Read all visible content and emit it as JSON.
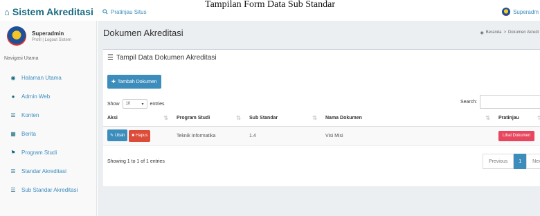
{
  "caption": "Tampilan Form Data Sub Standar",
  "brand": {
    "title": "Sistem Akreditasi",
    "home_icon": "home-icon"
  },
  "topbar": {
    "preview_link": "Pratinjau Situs",
    "user_name": "Superadm"
  },
  "sidebar": {
    "user_name": "Superadmin",
    "profile_link": "Profil",
    "logout_link": "Logout Sistem",
    "nav_header": "Navigasi Utama",
    "items": [
      {
        "label": "Halaman Utama",
        "icon": "dashboard-icon"
      },
      {
        "label": "Admin Web",
        "icon": "user-icon"
      },
      {
        "label": "Konten",
        "icon": "list-icon"
      },
      {
        "label": "Berita",
        "icon": "news-icon"
      },
      {
        "label": "Program Studi",
        "icon": "flag-icon"
      },
      {
        "label": "Standar Akreditasi",
        "icon": "list-icon"
      },
      {
        "label": "Sub Standar Akreditasi",
        "icon": "list-icon"
      }
    ]
  },
  "main": {
    "page_title": "Dokumen Akreditasi",
    "breadcrumb": {
      "home": "Beranda",
      "current": "Dokumen Akredi"
    },
    "box_title": "Tampil Data Dokumen Akreditasi",
    "add_button": "Tambah Dokumen",
    "show_label": "Show",
    "entries_value": "10",
    "entries_label": "entries",
    "search_label": "Search:",
    "columns": [
      "Aksi",
      "Program Studi",
      "Sub Standar",
      "Nama Dokumen",
      "Pratinjau"
    ],
    "rows": [
      {
        "edit": "Ubah",
        "delete": "Hapus",
        "program_studi": "Teknik Informatika",
        "sub_standar": "1.4",
        "nama_dokumen": "Visi Misi",
        "view": "Lihat Dokumen"
      }
    ],
    "info": "Showing 1 to 1 of 1 entries",
    "pagination": {
      "previous": "Previous",
      "current": "1",
      "next": "Next"
    }
  }
}
